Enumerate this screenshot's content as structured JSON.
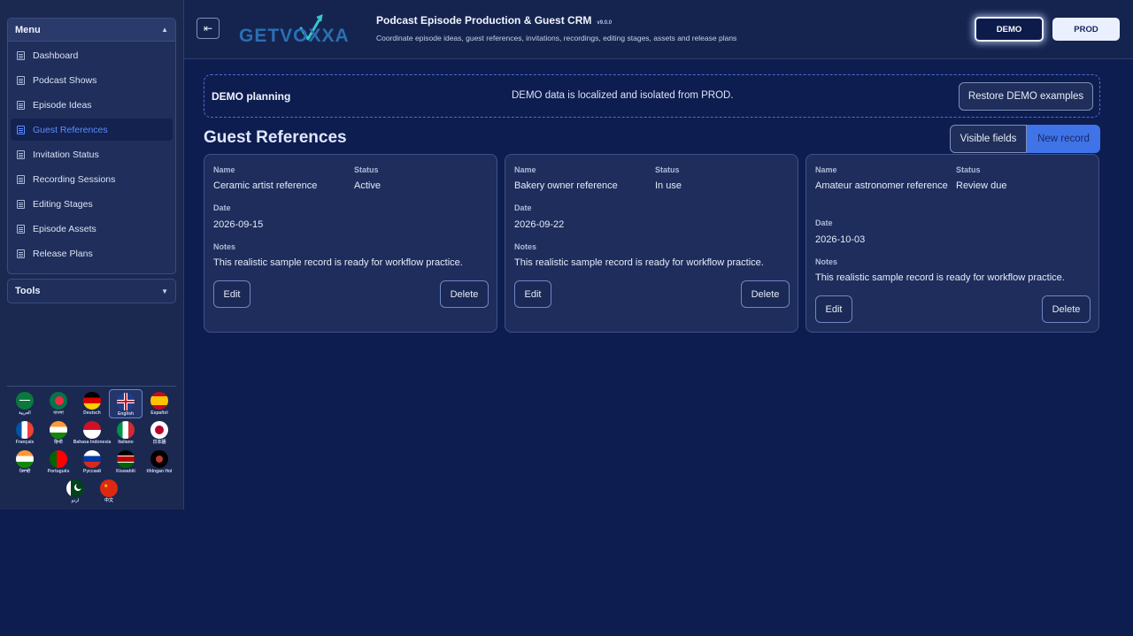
{
  "sidebar": {
    "menu_title": "Menu",
    "tools_title": "Tools",
    "items": [
      {
        "label": "Dashboard"
      },
      {
        "label": "Podcast Shows"
      },
      {
        "label": "Episode Ideas"
      },
      {
        "label": "Guest References",
        "active": true
      },
      {
        "label": "Invitation Status"
      },
      {
        "label": "Recording Sessions"
      },
      {
        "label": "Editing Stages"
      },
      {
        "label": "Episode Assets"
      },
      {
        "label": "Release Plans"
      }
    ],
    "languages": [
      {
        "name": "العربية",
        "flag": "sa"
      },
      {
        "name": "বাংলা",
        "flag": "bd"
      },
      {
        "name": "Deutsch",
        "flag": "de"
      },
      {
        "name": "English",
        "flag": "gb",
        "active": true
      },
      {
        "name": "Español",
        "flag": "es"
      },
      {
        "name": "Français",
        "flag": "fr"
      },
      {
        "name": "हिन्दी",
        "flag": "in"
      },
      {
        "name": "Bahasa Indonesia",
        "flag": "id"
      },
      {
        "name": "Italiano",
        "flag": "it"
      },
      {
        "name": "日本語",
        "flag": "jp"
      },
      {
        "name": "ਪੰਜਾਬੀ",
        "flag": "in"
      },
      {
        "name": "Português",
        "flag": "pt"
      },
      {
        "name": "Русский",
        "flag": "ru"
      },
      {
        "name": "Kiswahili",
        "flag": "ke"
      },
      {
        "name": "tlhIngan Hol",
        "flag": "kl"
      },
      {
        "name": "اردو",
        "flag": "pk"
      },
      {
        "name": "中文",
        "flag": "cn"
      }
    ]
  },
  "header": {
    "logo_text": "GETVOXXA",
    "title": "Podcast Episode Production & Guest CRM",
    "version": "v9.0.0",
    "subtitle": "Coordinate episode ideas, guest references, invitations, recordings, editing stages, assets and release plans",
    "demo_label": "DEMO",
    "prod_label": "PROD"
  },
  "banner": {
    "title": "DEMO planning",
    "message": "DEMO data is localized and isolated from PROD.",
    "restore_label": "Restore DEMO examples"
  },
  "main": {
    "title": "Guest References",
    "visible_fields_label": "Visible fields",
    "new_record_label": "New record",
    "labels": {
      "name": "Name",
      "status": "Status",
      "date": "Date",
      "notes": "Notes",
      "edit": "Edit",
      "delete": "Delete"
    },
    "cards": [
      {
        "name": "Ceramic artist reference",
        "status": "Active",
        "date": "2026-09-15",
        "notes": "This realistic sample record is ready for workflow practice."
      },
      {
        "name": "Bakery owner reference",
        "status": "In use",
        "date": "2026-09-22",
        "notes": "This realistic sample record is ready for workflow practice."
      },
      {
        "name": "Amateur astronomer reference",
        "status": "Review due",
        "date": "2026-10-03",
        "notes": "This realistic sample record is ready for workflow practice."
      }
    ]
  },
  "colors": {
    "page_bg": "#0e1d4f",
    "sidebar_bg": "#1b2951",
    "accent": "#3f73e8",
    "active_link": "#5b8dff"
  }
}
